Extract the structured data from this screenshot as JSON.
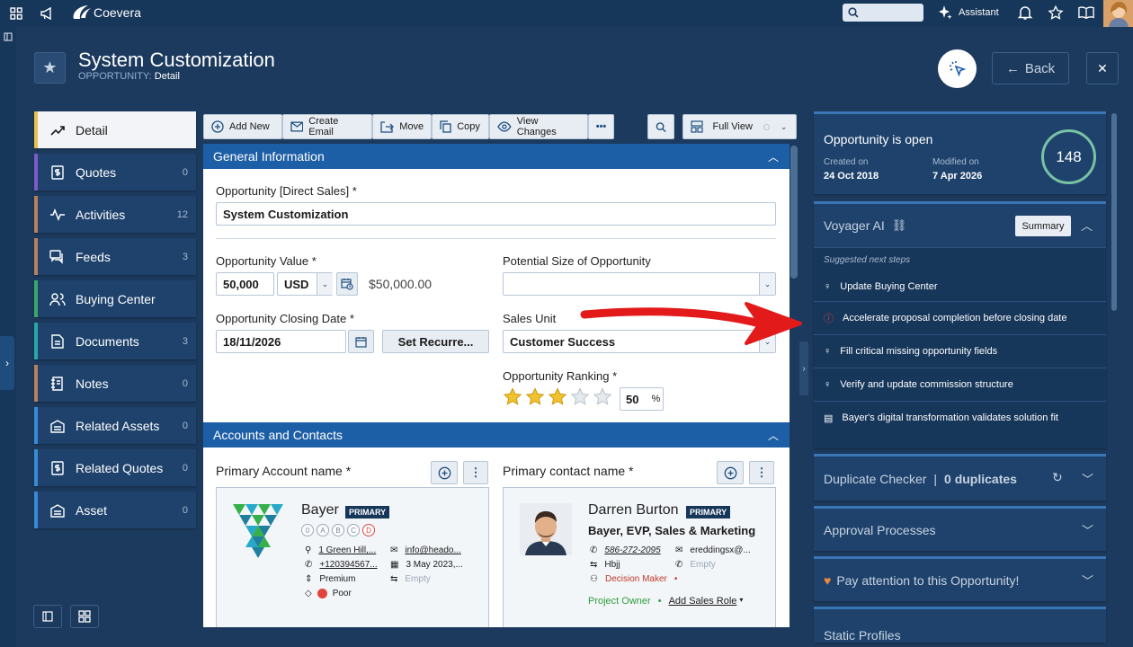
{
  "app": {
    "name": "Coevera",
    "search_placeholder": "",
    "assistant_label": "Assistant"
  },
  "header": {
    "title": "System Customization",
    "entity": "OPPORTUNITY:",
    "view": "Detail",
    "back_label": "Back"
  },
  "nav": [
    {
      "label": "Detail",
      "count": "",
      "color": "#e8c14a"
    },
    {
      "label": "Quotes",
      "count": "0",
      "color": "#7b5cc9"
    },
    {
      "label": "Activities",
      "count": "12",
      "color": "#b7805a"
    },
    {
      "label": "Feeds",
      "count": "3",
      "color": "#b7805a"
    },
    {
      "label": "Buying Center",
      "count": "",
      "color": "#3aa86a"
    },
    {
      "label": "Documents",
      "count": "3",
      "color": "#2da6a8"
    },
    {
      "label": "Notes",
      "count": "0",
      "color": "#b7805a"
    },
    {
      "label": "Related Assets",
      "count": "0",
      "color": "#3a8ad6"
    },
    {
      "label": "Related Quotes",
      "count": "0",
      "color": "#3a8ad6"
    },
    {
      "label": "Asset",
      "count": "0",
      "color": "#3a8ad6"
    }
  ],
  "toolbar": {
    "add_new": "Add New",
    "create_email": "Create Email",
    "move": "Move",
    "copy": "Copy",
    "view_changes": "View Changes",
    "full_view": "Full View"
  },
  "general": {
    "section_title": "General Information",
    "opp_label": "Opportunity [Direct Sales] *",
    "opp_value": "System Customization",
    "value_label": "Opportunity Value *",
    "value": "50,000",
    "currency": "USD",
    "converted": "$50,000.00",
    "size_label": "Potential Size of Opportunity",
    "size_value": "",
    "closing_label": "Opportunity Closing Date *",
    "closing_value": "18/11/2026",
    "recurrence_label": "Set Recurre...",
    "unit_label": "Sales Unit",
    "unit_value": "Customer Success",
    "ranking_label": "Opportunity Ranking *",
    "ranking_stars": 3,
    "ranking_max": 5,
    "ranking_value": "50",
    "ranking_unit": "%"
  },
  "accounts": {
    "section_title": "Accounts and Contacts",
    "account_label": "Primary Account name *",
    "account": {
      "name": "Bayer",
      "badge": "PRIMARY",
      "grades": [
        "0",
        "A",
        "B",
        "C",
        "D"
      ],
      "address": "1 Green Hill,...",
      "email": "info@heado...",
      "phone": "+120394567...",
      "date": "3 May 2023,...",
      "tier": "Premium",
      "rating": "Poor",
      "empty": "Empty"
    },
    "contact_label": "Primary contact name *",
    "contact": {
      "name": "Darren Burton",
      "badge": "PRIMARY",
      "company": "Bayer, EVP, Sales & Marketing",
      "phone": "586-272-2095",
      "email": "ereddingsx@...",
      "handle": "Hbjj",
      "empty": "Empty",
      "role": "Decision Maker",
      "owner": "Project Owner",
      "add_role": "Add Sales Role"
    }
  },
  "right": {
    "status_title": "Opportunity is open",
    "created_label": "Created on",
    "created_value": "24 Oct 2018",
    "modified_label": "Modified on",
    "modified_value": "7 Apr 2026",
    "score": "148",
    "ai_title": "Voyager AI",
    "summary_label": "Summary",
    "suggested_label": "Suggested next steps",
    "suggestions": [
      "Update Buying Center",
      "Accelerate proposal completion before closing date",
      "Fill critical missing opportunity fields",
      "Verify and update commission structure",
      "Bayer's digital transformation validates solution fit"
    ],
    "dup_label": "Duplicate Checker",
    "dup_count": "0 duplicates",
    "approval_label": "Approval Processes",
    "attention_label": "Pay attention to this Opportunity!",
    "static_label": "Static Profiles"
  },
  "colors": {
    "accent": "#1d5fa6",
    "annotation_arrow": "#e31a1a",
    "warning": "#e0463b",
    "role": "#c0392b",
    "owner": "#2e9e3c"
  }
}
